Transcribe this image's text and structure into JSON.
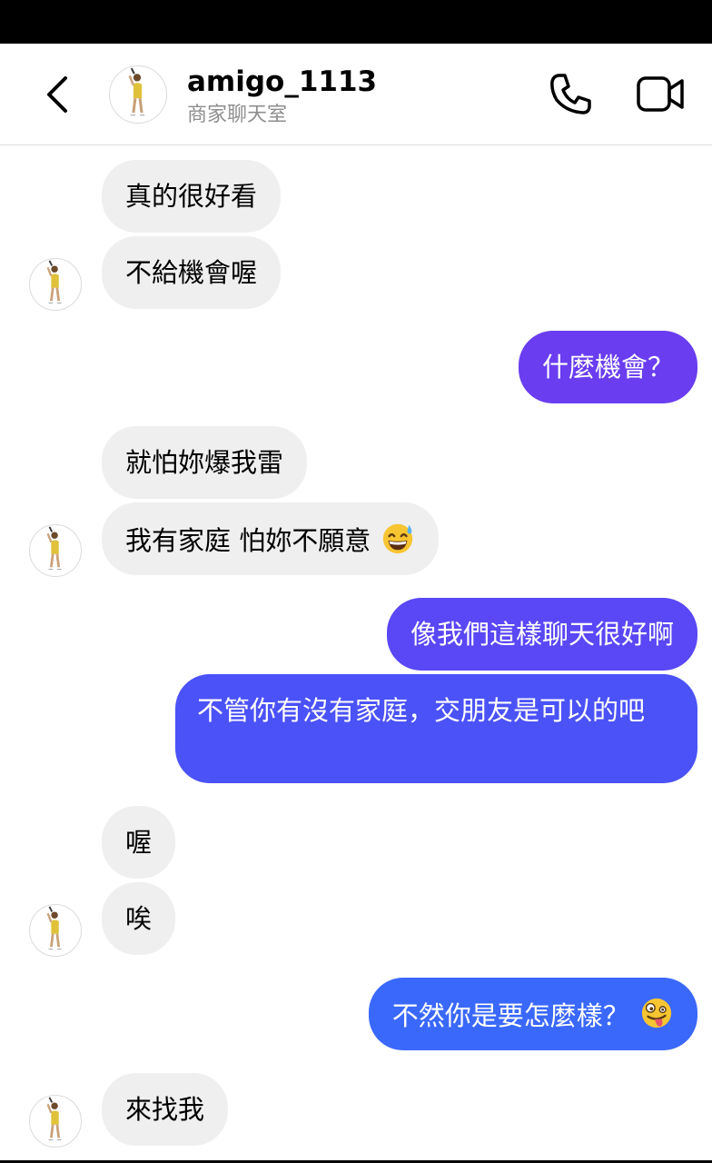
{
  "header": {
    "username": "amigo_1113",
    "subtitle": "商家聊天室"
  },
  "icons": {
    "back": "chevron-left-icon",
    "call": "phone-icon",
    "video": "video-camera-icon",
    "emoji_sweat": "grinning-face-with-sweat-emoji",
    "emoji_zany": "zany-face-emoji"
  },
  "colors": {
    "incoming_bubble": "#efefef",
    "outgoing_purple": "#6a3df0",
    "outgoing_blue": "#3a68fb",
    "subtitle_gray": "#8e8e8e"
  },
  "messages": [
    {
      "from": "them",
      "text": "真的很好看"
    },
    {
      "from": "them",
      "text": "不給機會喔"
    },
    {
      "from": "me",
      "text": "什麼機會？"
    },
    {
      "from": "them",
      "text": "就怕妳爆我雷"
    },
    {
      "from": "them",
      "text": "我有家庭 怕妳不願意"
    },
    {
      "from": "me",
      "text": "像我們這樣聊天很好啊"
    },
    {
      "from": "me",
      "text": "不管你有沒有家庭，交朋友是可以的吧"
    },
    {
      "from": "them",
      "text": "喔"
    },
    {
      "from": "them",
      "text": "唉"
    },
    {
      "from": "me",
      "text": "不然你是要怎麼樣？"
    },
    {
      "from": "them",
      "text": "來找我"
    }
  ]
}
